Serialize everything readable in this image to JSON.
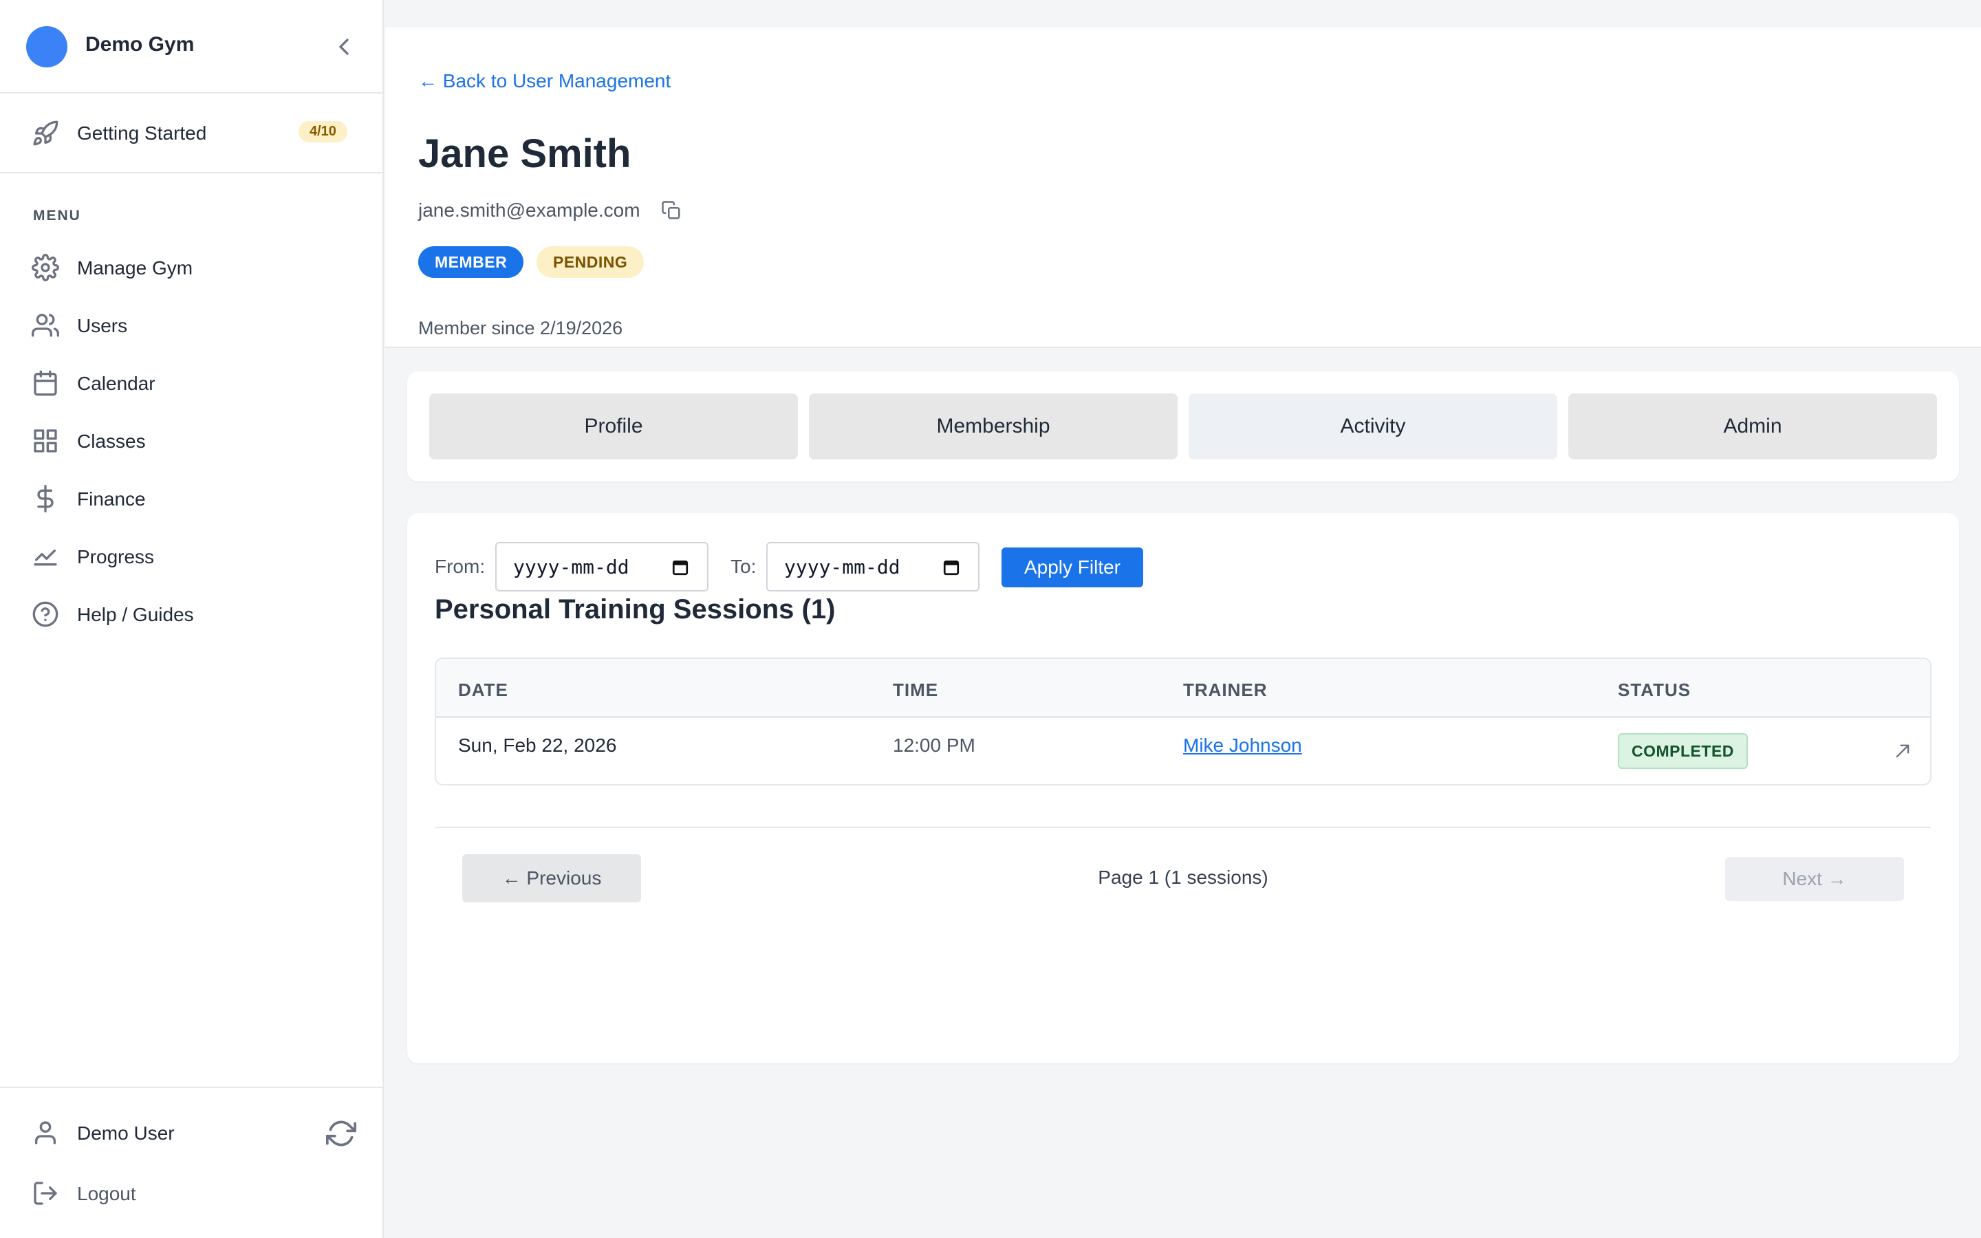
{
  "sidebar": {
    "brand": "Demo Gym",
    "getting_started": {
      "label": "Getting Started",
      "progress": "4/10"
    },
    "menu_title": "MENU",
    "items": [
      {
        "label": "Manage Gym",
        "icon": "gear-icon"
      },
      {
        "label": "Users",
        "icon": "users-icon"
      },
      {
        "label": "Calendar",
        "icon": "calendar-icon"
      },
      {
        "label": "Classes",
        "icon": "grid-icon"
      },
      {
        "label": "Finance",
        "icon": "dollar-icon"
      },
      {
        "label": "Progress",
        "icon": "chart-icon"
      },
      {
        "label": "Help / Guides",
        "icon": "help-icon"
      }
    ],
    "footer": {
      "user": "Demo User",
      "logout": "Logout"
    }
  },
  "header": {
    "back_link": "← Back to User Management",
    "name": "Jane Smith",
    "email": "jane.smith@example.com",
    "role_badge": "MEMBER",
    "status_badge": "PENDING",
    "member_since": "Member since 2/19/2026"
  },
  "tabs": [
    "Profile",
    "Membership",
    "Activity",
    "Admin"
  ],
  "active_tab": "Activity",
  "filter": {
    "from_label": "From:",
    "to_label": "To:",
    "from_placeholder": "yyyy-mm-dd",
    "to_placeholder": "yyyy-mm-dd",
    "apply_label": "Apply Filter"
  },
  "sessions": {
    "title": "Personal Training Sessions (1)",
    "columns": [
      "DATE",
      "TIME",
      "TRAINER",
      "STATUS"
    ],
    "rows": [
      {
        "date": "Sun, Feb 22, 2026",
        "time": "12:00 PM",
        "trainer": "Mike Johnson",
        "status": "COMPLETED"
      }
    ]
  },
  "pagination": {
    "previous": "← Previous",
    "info": "Page 1 (1 sessions)",
    "next": "Next →"
  },
  "colors": {
    "accent": "#1a73e8",
    "brand_logo": "#3b82f6",
    "pending_bg": "#fdf0c7",
    "completed_bg": "#dcf3e3"
  }
}
